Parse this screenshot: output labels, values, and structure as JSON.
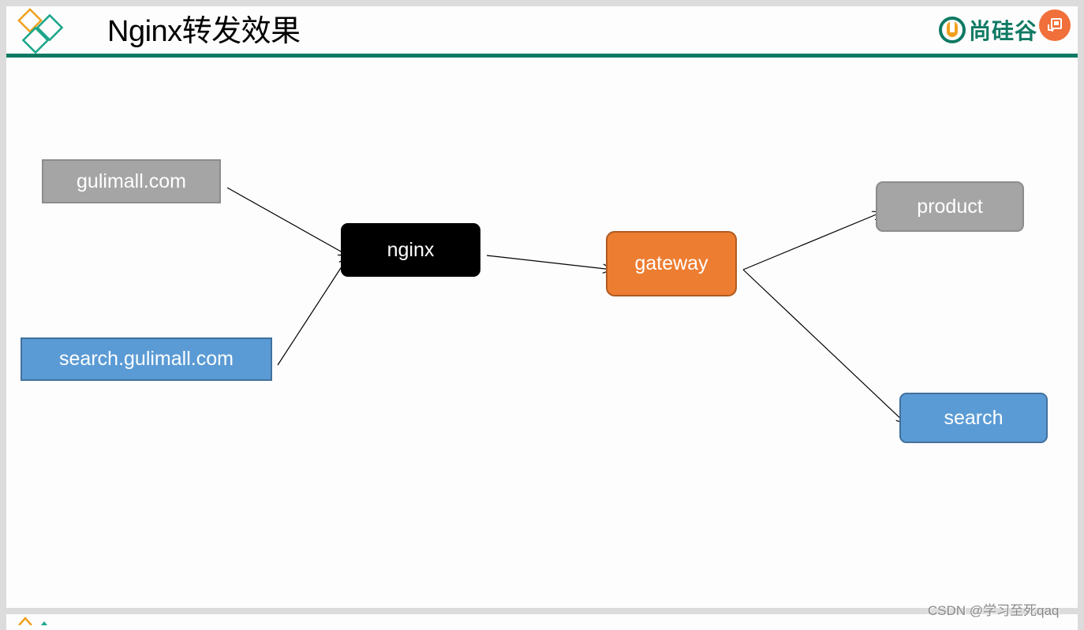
{
  "slide": {
    "title": "Nginx转发效果",
    "brand": {
      "name": "尚硅谷",
      "logo_icon": "u-logo-icon"
    },
    "share_icon": "share-icon",
    "colors": {
      "accent_green": "#0f7a63",
      "logo_orange": "#f0a01e",
      "logo_teal": "#1aa68a",
      "gray_node": "#a5a5a5",
      "blue_node": "#5b9bd5",
      "black_node": "#000000",
      "orange_node": "#ed7d31"
    }
  },
  "diagram": {
    "nodes": [
      {
        "id": "gulimall",
        "label": "gulimall.com"
      },
      {
        "id": "search-domain",
        "label": "search.gulimall.com"
      },
      {
        "id": "nginx",
        "label": "nginx"
      },
      {
        "id": "gateway",
        "label": "gateway"
      },
      {
        "id": "product",
        "label": "product"
      },
      {
        "id": "search",
        "label": "search"
      }
    ],
    "edges": [
      {
        "from": "gulimall",
        "to": "nginx"
      },
      {
        "from": "search-domain",
        "to": "nginx"
      },
      {
        "from": "nginx",
        "to": "gateway"
      },
      {
        "from": "gateway",
        "to": "product"
      },
      {
        "from": "gateway",
        "to": "search"
      }
    ]
  },
  "watermark": "CSDN @学习至死qaq"
}
